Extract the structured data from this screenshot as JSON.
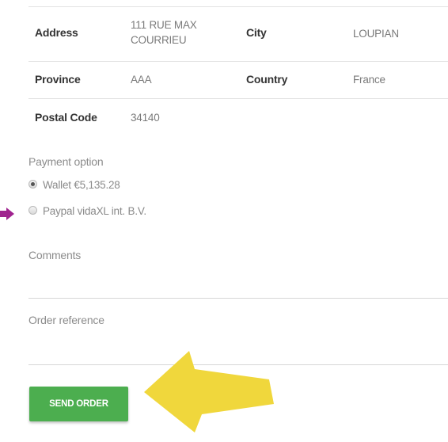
{
  "address_table": {
    "rows": [
      {
        "label1": "Address",
        "value1": "111 RUE MAX COURRIEU",
        "label2": "City",
        "value2": "LOUPIAN"
      },
      {
        "label1": "Province",
        "value1": "AAA",
        "label2": "Country",
        "value2": "France"
      },
      {
        "label1": "Postal Code",
        "value1": "34140"
      }
    ]
  },
  "payment": {
    "heading": "Payment option",
    "options": [
      {
        "label": "Wallet €5,135.28",
        "selected": true
      },
      {
        "label": "Paypal vidaXL int. B.V.",
        "selected": false
      }
    ]
  },
  "comments": {
    "label": "Comments",
    "value": ""
  },
  "order_reference": {
    "label": "Order reference",
    "value": ""
  },
  "send_order": {
    "label": "SEND ORDER",
    "color": "#4cae4f"
  },
  "annotations": {
    "small_arrow_color": "#a0238f",
    "big_arrow_color": "#f0d73c"
  }
}
